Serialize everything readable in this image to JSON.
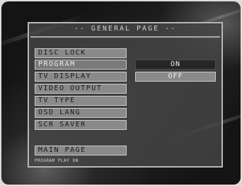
{
  "panel": {
    "title": "-- GENERAL PAGE --"
  },
  "menu": {
    "items": [
      {
        "label": "DISC LOCK"
      },
      {
        "label": "PROGRAM"
      },
      {
        "label": "TV DISPLAY"
      },
      {
        "label": "VIDEO OUTPUT"
      },
      {
        "label": "TV TYPE"
      },
      {
        "label": "OSD LANG"
      },
      {
        "label": "SCR SAVER"
      }
    ],
    "main_page": "MAIN PAGE",
    "selected_index": 1
  },
  "options": {
    "on": "ON",
    "off": "OFF",
    "selected": "ON"
  },
  "status": "PROGRAM PLAY ON",
  "colors": {
    "panel": "#464646",
    "item": "#8a8a8a",
    "highlight": "#262626",
    "border": "#b8b8b8"
  }
}
